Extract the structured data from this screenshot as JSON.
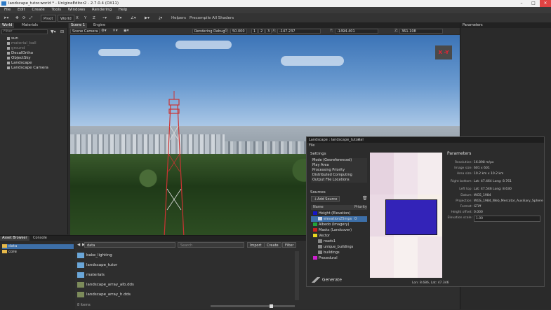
{
  "window": {
    "title": "landscape_tutor.world * - UnigineEditor2 - 2.7.0.4 (DX11)"
  },
  "menu": [
    "File",
    "Edit",
    "Create",
    "Tools",
    "Windows",
    "Rendering",
    "Help"
  ],
  "toolbar": {
    "pivot": "Pivot",
    "world": "World",
    "x": "X",
    "y": "Y",
    "z": "Z",
    "helpers": "Helpers",
    "precompile": "Precompile All Shaders"
  },
  "left_tabs": [
    "World",
    "Materials"
  ],
  "left_filter_placeholder": "Filter",
  "world_nodes": [
    {
      "label": "sun",
      "dim": false
    },
    {
      "label": "material_ball",
      "dim": true
    },
    {
      "label": "ground",
      "dim": true
    },
    {
      "label": "DecalOrtho",
      "dim": false
    },
    {
      "label": "ObjectSky",
      "dim": false
    },
    {
      "label": "Landscape",
      "dim": false
    },
    {
      "label": "Landscape Camera",
      "dim": false
    }
  ],
  "viewport_tabs": [
    "Scene 1",
    "Engine"
  ],
  "viewport_toolbar": {
    "camera": "Scene Camera",
    "mode": "Rendering Debug",
    "speed": "50.000",
    "btn1": "1",
    "btn2": "2",
    "btn3": "3",
    "x_label": "X:",
    "x_value": "-147.237",
    "y_label": "Y:",
    "y_value": "-1494.401",
    "z_label": "Z:",
    "z_value": "361.108"
  },
  "nav_cube": "X -Y",
  "right_panel": {
    "title": "Parameters"
  },
  "asset_browser": {
    "tabs": [
      "Asset Browser",
      "Console"
    ],
    "tree": [
      {
        "label": "data",
        "selected": true
      },
      {
        "label": "core",
        "selected": false
      }
    ],
    "path": "data",
    "search_placeholder": "Search",
    "buttons": [
      "Import",
      "Create",
      "Filter"
    ],
    "files": [
      {
        "name": "bake_lighting",
        "type": "folder"
      },
      {
        "name": "landscape_tutor",
        "type": "folder"
      },
      {
        "name": "materials",
        "type": "folder"
      },
      {
        "name": "landscape_array_alb.dds",
        "type": "dds"
      },
      {
        "name": "landscape_array_h.dds",
        "type": "dds"
      }
    ],
    "items_count": "8 items"
  },
  "landscape_window": {
    "title": "Landscape : landscape_tutorial",
    "menu": "File",
    "settings_header": "Settings",
    "settings": [
      "Mode (Georeferenced)",
      "Play Area",
      "Processing Priority",
      "Distributed Computing",
      "Output File Locations"
    ],
    "sources_header": "Sources",
    "add_source": "Add Source",
    "col_name": "Name",
    "col_priority": "Priority",
    "sources": [
      {
        "label": "Height (Elevation)",
        "color": "#1515c8",
        "indent": 0
      },
      {
        "label": "elevation25mps",
        "color": "#4a6fa8",
        "indent": 1,
        "priority": "0"
      },
      {
        "label": "Albedo (Imagery)",
        "color": "#22a23a",
        "indent": 0
      },
      {
        "label": "Masks (Landcover)",
        "color": "#c82020",
        "indent": 0
      },
      {
        "label": "Vector",
        "color": "#e8d820",
        "indent": 0
      },
      {
        "label": "roads1",
        "color": "#888888",
        "indent": 1
      },
      {
        "label": "unique_buildings",
        "color": "#888888",
        "indent": 1
      },
      {
        "label": "buildings",
        "color": "#888888",
        "indent": 1
      },
      {
        "label": "Procedural",
        "color": "#d020d0",
        "indent": 0
      }
    ],
    "parameters_title": "Parameters",
    "parameters": [
      {
        "label": "Resolution:",
        "value": "16.898 m/px"
      },
      {
        "label": "Image size:",
        "value": "601 x 601"
      },
      {
        "label": "Area size:",
        "value": "10.2 km x 10.2 km"
      },
      {
        "label": "Right bottom:",
        "value": "Lat: 47.464  Long: 8.761"
      },
      {
        "label": "Left top:",
        "value": "Lat: 47.546  Long: 8.630"
      },
      {
        "label": "Datum:",
        "value": "WGS_1984"
      },
      {
        "label": "Projection:",
        "value": "WGS_1984_Web_Mercator_Auxiliary_Sphere"
      },
      {
        "label": "Format:",
        "value": "GTiff"
      },
      {
        "label": "Height offset:",
        "value": "0.000"
      },
      {
        "label": "Elevation scale:",
        "value": "1.00"
      }
    ],
    "generate": "Generate",
    "status": "Lon: 8.686, Lat: 47.346"
  }
}
